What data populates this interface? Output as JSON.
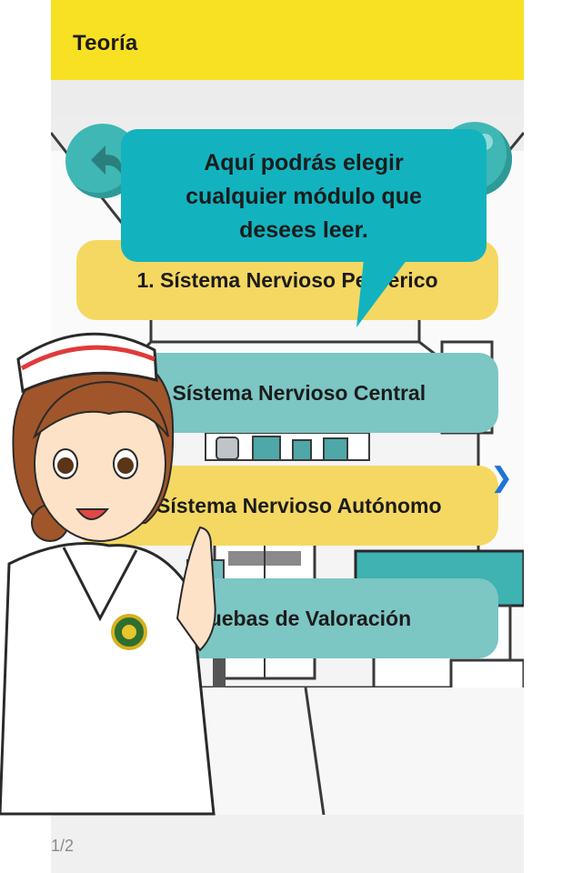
{
  "app_bar": {
    "title": "Teoría"
  },
  "tooltip": {
    "line1": "Aquí podrás elegir",
    "line2": "cualquier módulo que",
    "line3": "desees leer."
  },
  "modules": [
    {
      "label": "1. Sístema Nervioso Periférico",
      "color": "#f5d862"
    },
    {
      "label": "2. Sístema Nervioso Central",
      "color": "#7cc6c4"
    },
    {
      "label": "3. Sístema Nervioso Autónomo",
      "color": "#f5d862"
    },
    {
      "label": "4. Pruebas de Valoración",
      "color": "#7cc6c4"
    }
  ],
  "pager": {
    "text": "1/2"
  },
  "colors": {
    "app_bar": "#f8e023",
    "tooltip": "#12b3bf",
    "next_arrow": "#1e73d8"
  },
  "icons": {
    "back": "back-arrow-icon",
    "home": "home-icon",
    "next": "chevron-right-icon"
  }
}
